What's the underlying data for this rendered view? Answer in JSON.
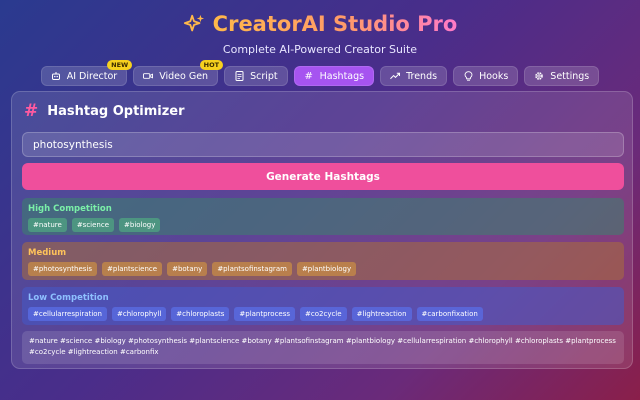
{
  "header": {
    "title": "CreatorAI Studio Pro",
    "subtitle": "Complete AI-Powered Creator Suite"
  },
  "tabs": [
    {
      "label": "AI Director",
      "icon": "robot-icon",
      "badge": "NEW",
      "active": false
    },
    {
      "label": "Video Gen",
      "icon": "video-camera-icon",
      "badge": "HOT",
      "active": false
    },
    {
      "label": "Script",
      "icon": "document-icon",
      "badge": "",
      "active": false
    },
    {
      "label": "Hashtags",
      "icon": "hash-icon",
      "badge": "",
      "active": true
    },
    {
      "label": "Trends",
      "icon": "trend-up-icon",
      "badge": "",
      "active": false
    },
    {
      "label": "Hooks",
      "icon": "lightbulb-icon",
      "badge": "",
      "active": false
    },
    {
      "label": "Settings",
      "icon": "gear-icon",
      "badge": "",
      "active": false
    }
  ],
  "panel": {
    "icon": "hash-icon",
    "title": "Hashtag Optimizer",
    "input_value": "photosynthesis",
    "generate_label": "Generate Hashtags"
  },
  "groups": {
    "high": {
      "label": "High Competition",
      "tags": [
        "#nature",
        "#science",
        "#biology"
      ]
    },
    "medium": {
      "label": "Medium",
      "tags": [
        "#photosynthesis",
        "#plantscience",
        "#botany",
        "#plantsofinstagram",
        "#plantbiology"
      ]
    },
    "low": {
      "label": "Low Competition",
      "tags": [
        "#cellularrespiration",
        "#chlorophyll",
        "#chloroplasts",
        "#plantprocess",
        "#co2cycle",
        "#lightreaction",
        "#carbonfixation"
      ]
    }
  },
  "all_tags": "#nature #science #biology #photosynthesis #plantscience #botany #plantsofinstagram #plantbiology #cellularrespiration #chlorophyll #chloroplasts #plantprocess #co2cycle #lightreaction #carbonfix",
  "colors": {
    "active_tab": "#a654f0",
    "generate_button": "#ef4f9c",
    "badge": "#f6d11e",
    "high_label": "#7af0a8",
    "medium_label": "#ffc35a",
    "low_label": "#8ec0ff"
  }
}
